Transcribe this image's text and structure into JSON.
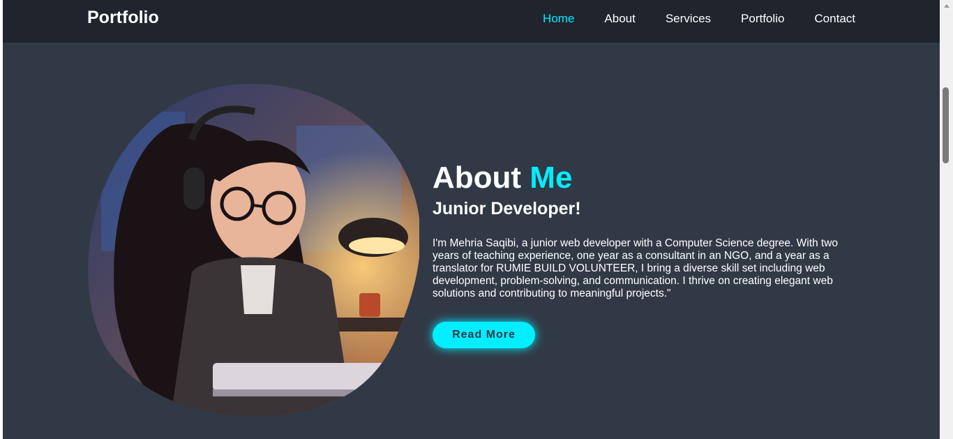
{
  "navbar": {
    "brand": "Portfolio",
    "links": [
      "Home",
      "About",
      "Services",
      "Portfolio",
      "Contact"
    ],
    "active": "Home"
  },
  "hero": {
    "image_alt": "Illustration of a girl with headphones and glasses working on a laptop at night",
    "title_part1": "About ",
    "title_accent": "Me",
    "subtitle": "Junior Developer!",
    "description": "I'm Mehria Saqibi, a junior web developer with a Computer Science degree. With two years of teaching experience, one year as a consultant in an NGO, and a year as a translator for RUMIE BUILD VOLUNTEER, I bring a diverse skill set including web development, problem-solving, and communication. I thrive on creating elegant web solutions and contributing to meaningful projects.\"",
    "button": "Read More"
  },
  "colors": {
    "accent": "#00eeff",
    "background": "#323946",
    "navbar": "#1f242d",
    "text": "#ffffff"
  }
}
